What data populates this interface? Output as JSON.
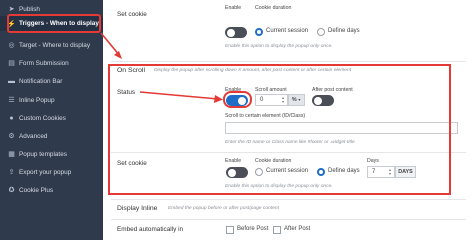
{
  "sidebar": {
    "items": [
      {
        "label": "Publish",
        "icon": "arrow-icon"
      },
      {
        "label": "Triggers - When to display",
        "icon": "bolt-icon",
        "active": true
      },
      {
        "label": "Target - Where to display",
        "icon": "target-icon"
      },
      {
        "label": "Form Submission",
        "icon": "form-icon"
      },
      {
        "label": "Notification Bar",
        "icon": "bar-icon"
      },
      {
        "label": "Inline Popup",
        "icon": "inline-icon"
      },
      {
        "label": "Custom Cookies",
        "icon": "cookie-icon"
      },
      {
        "label": "Advanced",
        "icon": "gear-icon"
      },
      {
        "label": "Popup templates",
        "icon": "template-icon"
      },
      {
        "label": "Export your popup",
        "icon": "export-icon"
      },
      {
        "label": "Cookie Plus",
        "icon": "cookie-plus-icon"
      }
    ]
  },
  "top_set_cookie": {
    "label": "Set cookie",
    "enable_label": "Enable",
    "duration_label": "Cookie duration",
    "current_session": "Current session",
    "define_days": "Define days",
    "help": "Enable this option to display the popup only once."
  },
  "on_scroll": {
    "title": "On Scroll",
    "description": "Display the popup after scrolling down X amount, after post content or after certain element",
    "status": {
      "label": "Status",
      "enable_label": "Enable",
      "scroll_amount_label": "Scroll amount",
      "scroll_amount_value": "0",
      "unit": "%",
      "after_post_label": "After post content"
    },
    "element": {
      "label": "Scroll to certain element (ID/Class)",
      "value": "",
      "help": "Enter the ID name or Class name like #footer or .widget-title"
    },
    "set_cookie": {
      "label": "Set cookie",
      "enable_label": "Enable",
      "duration_label": "Cookie duration",
      "current_session": "Current session",
      "define_days": "Define days",
      "days_label": "Days",
      "days_value": "7",
      "days_unit": "DAYS",
      "help": "Enable this option to display the popup only once."
    }
  },
  "display_inline": {
    "title": "Display Inline",
    "description": "Embed the popup before or after post/page content"
  },
  "embed": {
    "label": "Embed automatically in",
    "before_post": "Before Post",
    "after_post": "After Post"
  },
  "colors": {
    "sidebar_bg": "#2f3a4c",
    "accent": "#1e6ec8",
    "highlight": "#e53935"
  }
}
